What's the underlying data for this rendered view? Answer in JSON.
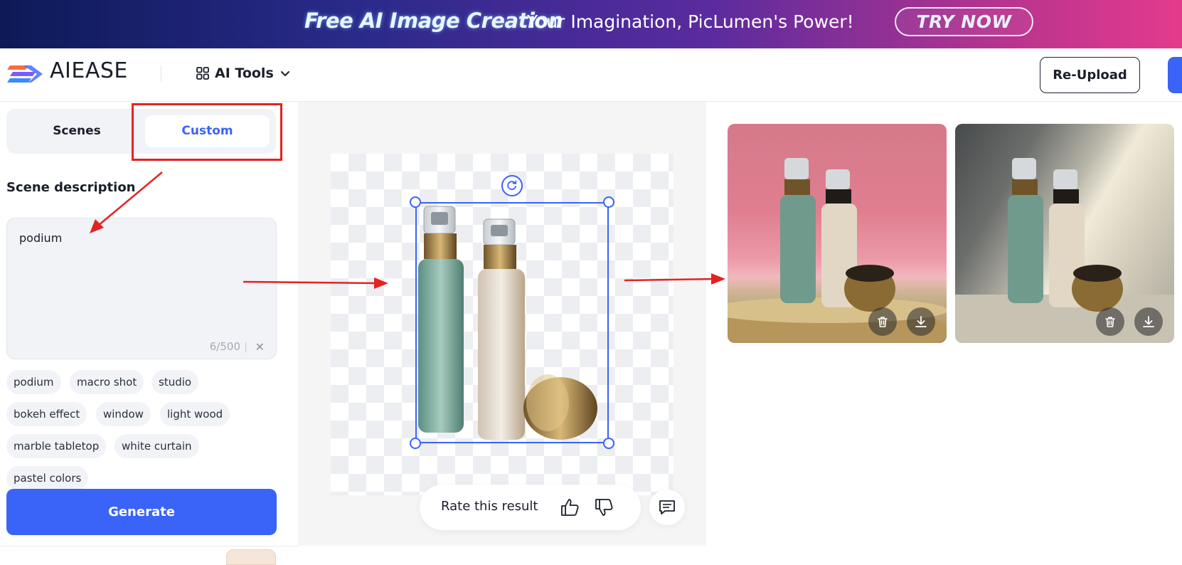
{
  "banner": {
    "title": "Free AI Image Creation",
    "subtitle": "Your Imagination, PicLumen's Power!",
    "cta": "TRY NOW"
  },
  "header": {
    "logo": "AIEASE",
    "ai_tools": "AI Tools",
    "reupload": "Re-Upload"
  },
  "tabs": {
    "scenes": "Scenes",
    "custom": "Custom",
    "active": "custom"
  },
  "scene": {
    "label": "Scene description",
    "value": "podium",
    "counter": "6/500"
  },
  "chips": [
    "podium",
    "macro shot",
    "studio",
    "bokeh effect",
    "window",
    "light wood",
    "marble tabletop",
    "white curtain",
    "pastel colors"
  ],
  "generate_label": "Generate",
  "rating": {
    "label": "Rate this result"
  },
  "colors": {
    "accent": "#3a63f7",
    "annotation_red": "#e52222",
    "panel_gray": "#f1f3f7"
  },
  "icons": {
    "ai_tools": "grid-icon",
    "chevron": "chevron-down-icon",
    "rotate": "rotate-icon",
    "thumbs_up": "thumbs-up-icon",
    "thumbs_down": "thumbs-down-icon",
    "feedback": "chat-icon",
    "delete": "trash-icon",
    "download": "download-icon"
  }
}
